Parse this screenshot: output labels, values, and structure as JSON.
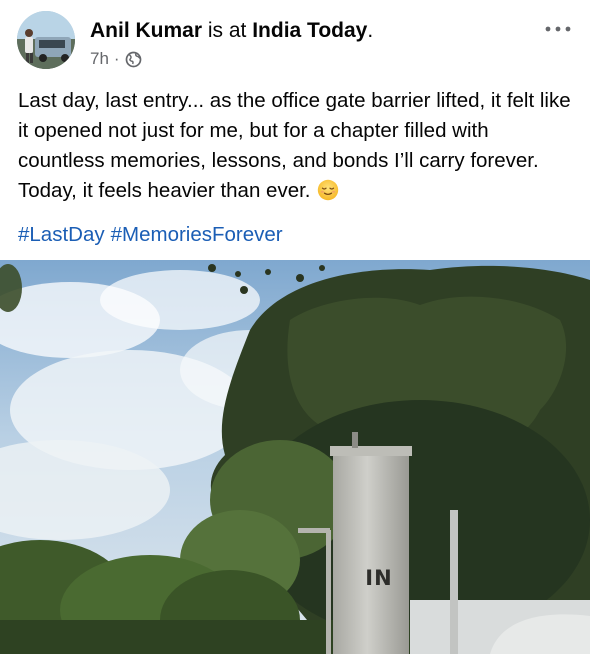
{
  "header": {
    "author": "Anil Kumar",
    "connector": "is at",
    "place": "India Today",
    "period": ".",
    "time": "7h",
    "separator": "·",
    "privacy_icon": "globe-icon",
    "more_icon": "more-horizontal-icon"
  },
  "post": {
    "text": "Last day, last entry... as the office gate barrier lifted, it felt like it opened not just for me, but for a chapter filled with countless memories, lessons, and bonds I’ll carry forever. Today, it feels heavier than ever.",
    "emoji_icon": "relieved-face-emoji-icon",
    "hashtags": [
      "#LastDay",
      "#MemoriesForever"
    ]
  },
  "photo": {
    "sign_text": "IN"
  },
  "colors": {
    "hashtag": "#1b5eb5",
    "meta": "#65676b",
    "text": "#050505"
  }
}
